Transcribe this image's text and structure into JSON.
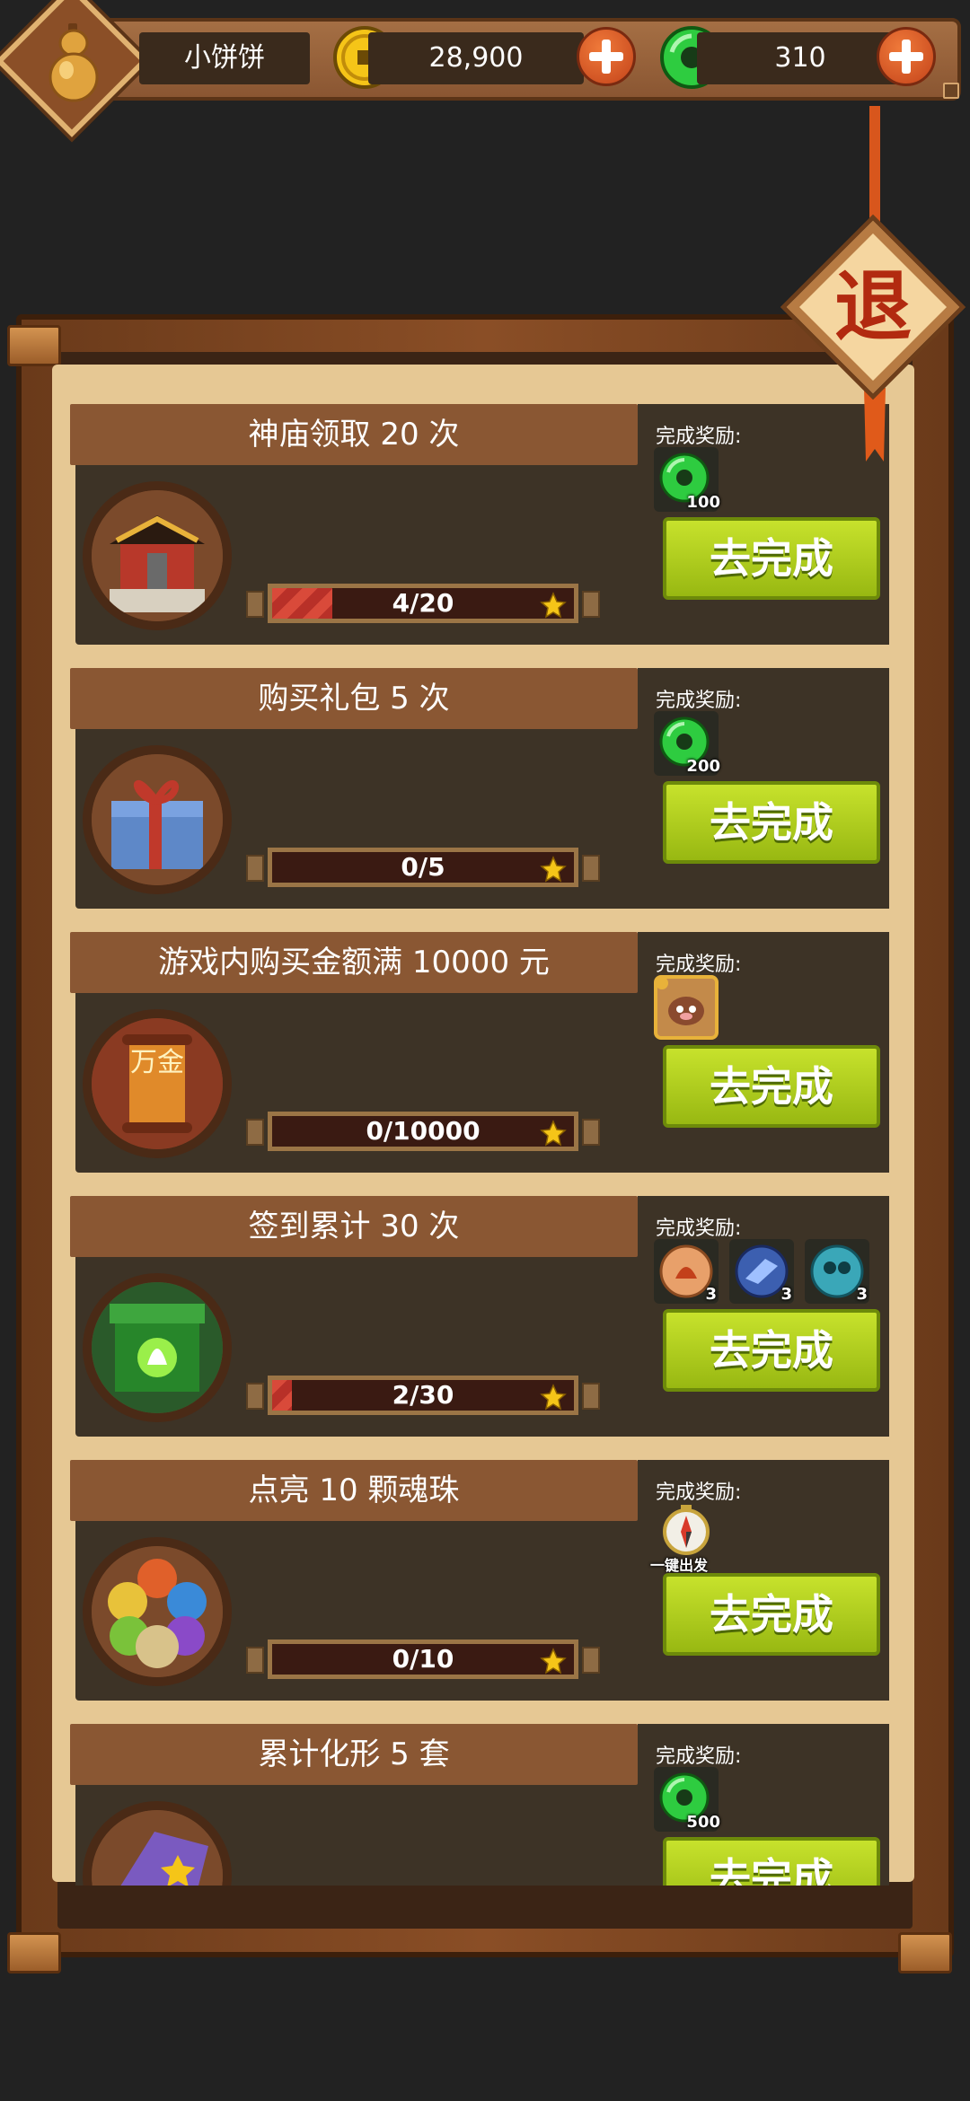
{
  "header": {
    "player_name": "小饼饼",
    "gold": "28,900",
    "jade": "310"
  },
  "exit_label": "退",
  "reward_label": "完成奖励:",
  "go_label": "去完成",
  "tasks": [
    {
      "title": "神庙领取 20 次",
      "progress": "4/20",
      "progress_fraction": 0.2,
      "rewards": [
        {
          "icon": "jade-icon",
          "count": "100"
        }
      ],
      "icon": "temple-icon"
    },
    {
      "title": "购买礼包 5 次",
      "progress": "0/5",
      "progress_fraction": 0,
      "rewards": [
        {
          "icon": "jade-icon",
          "count": "200"
        }
      ],
      "icon": "gift-box-icon"
    },
    {
      "title": "游戏内购买金额满 10000 元",
      "progress": "0/10000",
      "progress_fraction": 0,
      "rewards": [
        {
          "icon": "pet-card-icon",
          "count": ""
        }
      ],
      "icon": "scroll-icon",
      "icon_text": "万金"
    },
    {
      "title": "签到累计 30 次",
      "progress": "2/30",
      "progress_fraction": 0.0667,
      "rewards": [
        {
          "icon": "fire-orb-icon",
          "count": "3"
        },
        {
          "icon": "blue-orb-icon",
          "count": "3"
        },
        {
          "icon": "teal-orb-icon",
          "count": "3"
        }
      ],
      "icon": "green-gate-icon"
    },
    {
      "title": "点亮 10 颗魂珠",
      "progress": "0/10",
      "progress_fraction": 0,
      "rewards": [
        {
          "icon": "compass-icon",
          "count": "",
          "caption": "一键出发"
        }
      ],
      "icon": "soul-orbs-icon"
    },
    {
      "title": "累计化形 5 套",
      "progress": "",
      "progress_fraction": 0,
      "rewards": [
        {
          "icon": "jade-icon",
          "count": "500"
        }
      ],
      "icon": "wizard-hat-icon"
    }
  ],
  "colors": {
    "accent_green": "#b5d11f",
    "title_bar": "#8a5733",
    "progress_fill": "#d94a3a",
    "jade": "#2ecc40",
    "gold": "#f5c518"
  }
}
